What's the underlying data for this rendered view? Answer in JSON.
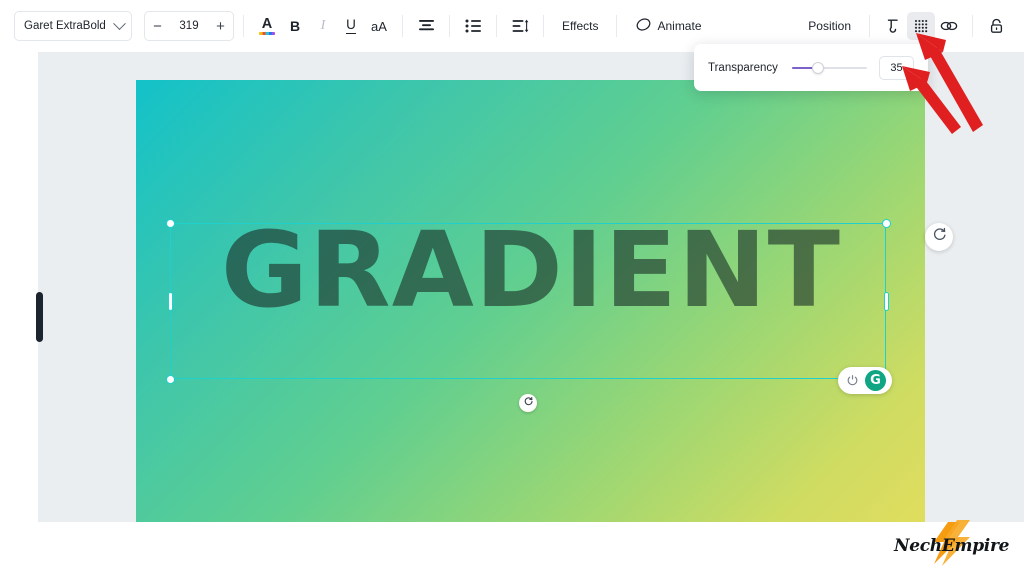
{
  "toolbar": {
    "font_family": "Garet ExtraBold",
    "font_size": "319",
    "decrease_label": "−",
    "increase_label": "+",
    "text_color_label": "A",
    "bold_label": "B",
    "italic_label": "I",
    "underline_label": "U",
    "case_label": "aA",
    "effects_label": "Effects",
    "animate_label": "Animate",
    "position_label": "Position",
    "icons": {
      "font_dropdown": "chevron-down-icon",
      "text_color": "text-color-icon",
      "align": "align-center-icon",
      "list": "bullet-list-icon",
      "spacing": "line-spacing-icon",
      "animate": "animate-icon",
      "copy_style": "copy-style-icon",
      "transparency": "transparency-icon",
      "link": "link-icon",
      "lock": "lock-icon"
    }
  },
  "transparency_panel": {
    "label": "Transparency",
    "value": "35",
    "slider_percent": 35,
    "accent_color": "#7b61c9"
  },
  "canvas": {
    "text": "GRADIENT",
    "text_color": "rgba(28,48,40,0.62)",
    "gradient_start": "#13c2c9",
    "gradient_mid": "#62cf8f",
    "gradient_end": "#e0dd5e",
    "selection_color": "#1fd0cd"
  },
  "widgets": {
    "rotate_icon": "rotate-icon",
    "move_icon": "move-handle-icon",
    "grammarly_power_icon": "power-icon",
    "grammarly_label": "G",
    "panel_handle": "panel-collapse-handle"
  },
  "annotations": {
    "arrow_one": "red-arrow-to-transparency-icon",
    "arrow_two": "red-arrow-to-transparency-value"
  },
  "watermark": {
    "text": "NechEmpire"
  }
}
